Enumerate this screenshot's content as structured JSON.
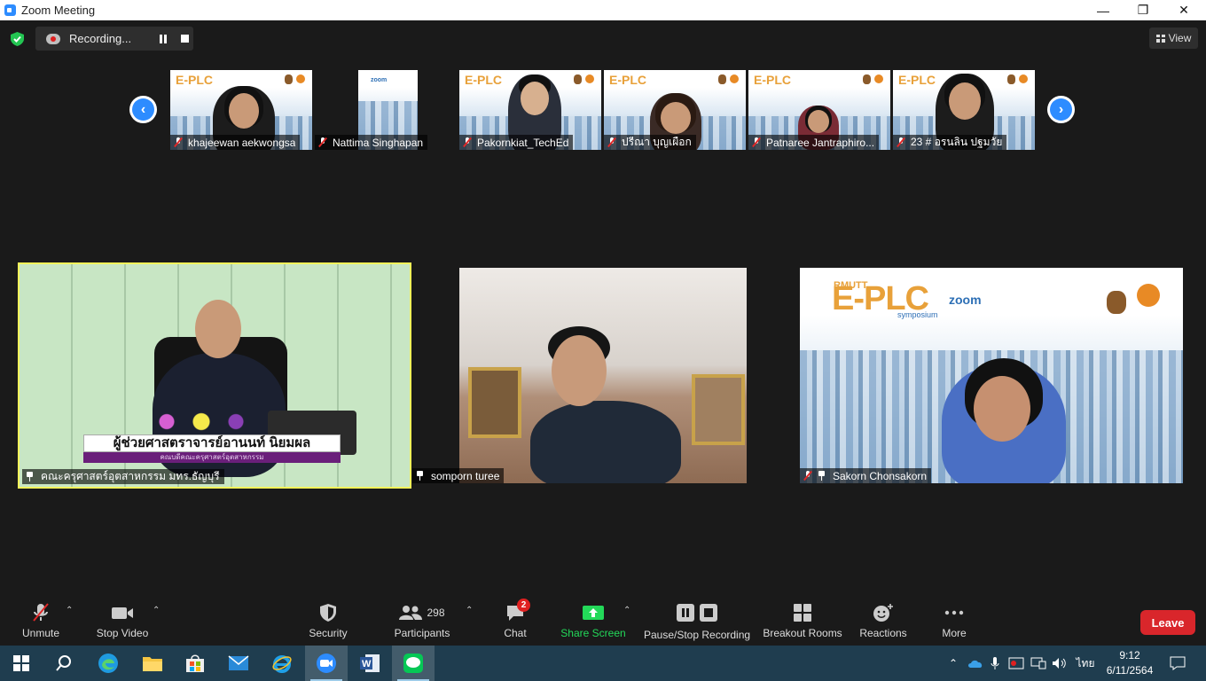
{
  "window": {
    "title": "Zoom Meeting",
    "minimize": "—",
    "restore": "❐",
    "close": "✕"
  },
  "recording": {
    "label": "Recording..."
  },
  "view_button": {
    "label": "View"
  },
  "thumbnails": [
    {
      "name": "khajeewan aekwongsa",
      "muted": true
    },
    {
      "name": "Nattima Singhapan",
      "muted": true
    },
    {
      "name": "Pakornkiat_TechEd",
      "muted": true
    },
    {
      "name": "ปรีณา บุญเผือก",
      "muted": true
    },
    {
      "name": "Patnaree Jantraphiro...",
      "muted": true
    },
    {
      "name": "23 # อรนลิน ปฐมวัย",
      "muted": true
    }
  ],
  "thumbnail_branding": {
    "logo": "E-PLC",
    "zoom": "zoom"
  },
  "main_tiles": [
    {
      "name": "คณะครุศาสตร์อุตสาหกรรม มทร.ธัญบุรี",
      "banner_main": "ผู้ช่วยศาสตราจารย์อานนท์ นิยมผล",
      "banner_sub": "คณบดีคณะครุศาสตร์อุตสาหกรรม"
    },
    {
      "name": "somporn turee"
    },
    {
      "name": "Sakorn  Chonsakorn",
      "logo_small": "RMUTT",
      "logo": "E-PLC",
      "logo_sub": "symposium",
      "zoom": "zoom"
    }
  ],
  "toolbar": {
    "unmute": "Unmute",
    "stop_video": "Stop Video",
    "security": "Security",
    "participants": "Participants",
    "participants_count": "298",
    "chat": "Chat",
    "chat_badge": "2",
    "share_screen": "Share Screen",
    "pause_stop_recording": "Pause/Stop Recording",
    "breakout_rooms": "Breakout Rooms",
    "reactions": "Reactions",
    "more": "More",
    "leave": "Leave"
  },
  "taskbar": {
    "language": "ไทย",
    "time": "9:12",
    "date": "6/11/2564"
  },
  "colors": {
    "accent": "#2d8cff",
    "share_green": "#23d959",
    "leave_red": "#d9262b",
    "active_speaker": "#f4f25a"
  }
}
